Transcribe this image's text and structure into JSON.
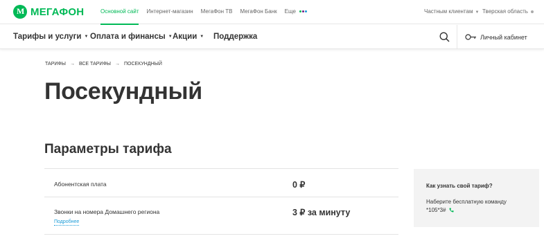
{
  "brand": {
    "name": "МегаФон",
    "logo_text": "МЕГАФОН",
    "color": "#00b956"
  },
  "topbar": {
    "links": [
      {
        "label": "Основной сайт",
        "active": true
      },
      {
        "label": "Интернет-магазин",
        "active": false
      },
      {
        "label": "МегаФон ТВ",
        "active": false
      },
      {
        "label": "МегаФон Банк",
        "active": false
      },
      {
        "label": "Еще",
        "active": false
      }
    ],
    "more_dot_colors": [
      "#00b956",
      "#731982",
      "#1a9bd7"
    ],
    "segment": "Частным клиентам",
    "region": "Тверская область"
  },
  "mainnav": {
    "items": [
      "Тарифы и услуги",
      "Оплата и финансы",
      "Акции",
      "Поддержка"
    ],
    "cabinet": "Личный кабинет"
  },
  "breadcrumb": [
    "Тарифы",
    "Все тарифы",
    "Посекундный"
  ],
  "page_title": "Посекундный",
  "section_title": "Параметры тарифа",
  "params": [
    {
      "label": "Абонентская плата",
      "value": "0 ₽"
    },
    {
      "label": "Звонки на номера Домашнего региона",
      "value": "3 ₽ за минуту",
      "link": "Подробнее"
    }
  ],
  "sidebox": {
    "title": "Как узнать свой тариф?",
    "text": "Наберите бесплатную команду",
    "command": "*105*3#"
  },
  "icons": {
    "search": "search-icon",
    "cabinet": "key-icon",
    "phone": "phone-icon"
  }
}
